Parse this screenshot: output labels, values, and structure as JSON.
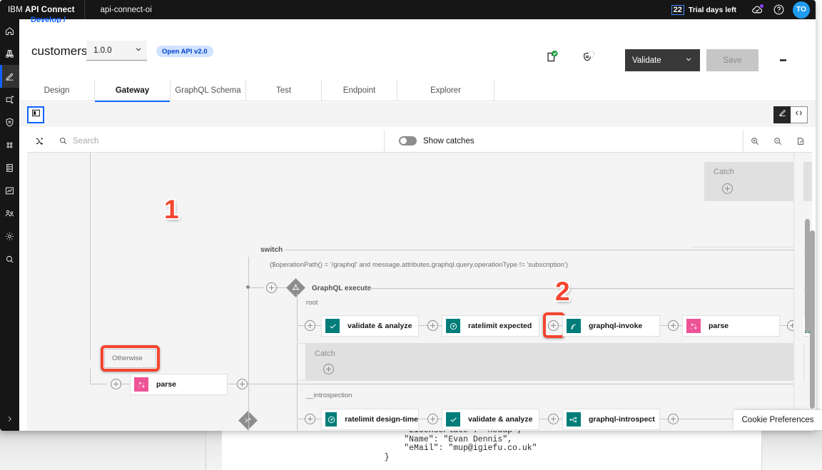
{
  "topbar": {
    "brand_prefix": "IBM ",
    "brand_name": "API Connect",
    "org": "api-connect-oi",
    "trial_days": "22",
    "trial_label": "Trial days left",
    "notifications_icon": "cloud-notification-icon",
    "help_icon": "help-circle-icon",
    "avatar_initials": "TO"
  },
  "rail": {
    "items": [
      {
        "name": "home",
        "icon": "home-icon"
      },
      {
        "name": "explore",
        "icon": "binoculars-icon"
      },
      {
        "name": "develop",
        "icon": "pencil-icon",
        "active": true
      },
      {
        "name": "manage",
        "icon": "deploy-icon"
      },
      {
        "name": "security",
        "icon": "shield-icon"
      },
      {
        "name": "apps",
        "icon": "grid-apps-icon"
      },
      {
        "name": "catalogs",
        "icon": "database-icon"
      },
      {
        "name": "analytics",
        "icon": "chart-line-icon"
      },
      {
        "name": "members",
        "icon": "users-icon"
      },
      {
        "name": "settings",
        "icon": "gear-icon"
      },
      {
        "name": "search",
        "icon": "search-icon"
      }
    ],
    "expand_icon": "chevron-right-icon"
  },
  "breadcrumb": "Develop /",
  "api": {
    "title": "customers",
    "version": "1.0.0",
    "version_chevron": "chevron-down-icon",
    "badge": "Open API v2.0",
    "status_icons": [
      {
        "name": "document-validated-icon"
      },
      {
        "name": "shield-pending-icon"
      }
    ],
    "validate_label": "Validate",
    "validate_chevron": "chevron-down-icon",
    "save_label": "Save",
    "overflow_icon": "kebab-menu-icon"
  },
  "tabs": [
    {
      "label": "Design",
      "active": false
    },
    {
      "label": "Gateway",
      "active": true
    },
    {
      "label": "GraphQL Schema",
      "active": false
    },
    {
      "label": "Test",
      "active": false
    },
    {
      "label": "Endpoint",
      "active": false
    },
    {
      "label": "Explorer",
      "active": false
    }
  ],
  "gateway_strip": {
    "panel_toggle_icon": "side-panel-icon",
    "editor_mode_icon": "edit-pencil-icon",
    "source_mode_icon": "code-brackets-icon"
  },
  "optionbar": {
    "shuffle_icon": "shuffle-icon",
    "search_icon": "search-icon",
    "search_placeholder": "Search",
    "search_value": "",
    "show_catches_label": "Show catches",
    "show_catches_on": false,
    "zoom_in_icon": "zoom-in-icon",
    "zoom_out_icon": "zoom-out-icon",
    "fit_icon": "fit-to-screen-icon"
  },
  "flow": {
    "otherwise_label": "Otherwise",
    "annotation_1": "1",
    "annotation_2": "2",
    "switch_title": "switch",
    "switch_condition": "($operationPath() = '/graphql' and message.attributes.graphql.query.operationType != 'subscription')",
    "graphql_execute_title": "GraphQL execute",
    "root_label": "root",
    "introspection_label": "__introspection",
    "catch_label": "Catch",
    "otherwise_row": [
      {
        "label": "parse",
        "icon": "parse-icon",
        "color": "pink"
      }
    ],
    "root_row": [
      {
        "label": "validate & analyze",
        "icon": "check-icon",
        "color": "teal"
      },
      {
        "label": "ratelimit expected",
        "icon": "gauge-icon",
        "color": "teal"
      },
      {
        "label": "graphql-invoke",
        "icon": "signal-icon",
        "color": "teal"
      },
      {
        "label": "parse",
        "icon": "parse-icon",
        "color": "pink"
      },
      {
        "label": "",
        "icon": "check-icon",
        "color": "teal"
      }
    ],
    "introspection_row": [
      {
        "label": "ratelimit design-time",
        "icon": "gauge-icon",
        "color": "teal"
      },
      {
        "label": "validate & analyze",
        "icon": "check-icon",
        "color": "teal"
      },
      {
        "label": "graphql-introspect",
        "icon": "introspect-icon",
        "color": "teal"
      }
    ]
  },
  "cookie": {
    "label": "Cookie Preferences"
  },
  "code_preview": {
    "line1": "        \"LicensePlate\": \"nedup\",",
    "line2": "        \"Name\": \"Evan Dennis\",",
    "line3": "        \"eMail\": \"mup@igiefu.co.uk\"",
    "line4": "    }"
  }
}
